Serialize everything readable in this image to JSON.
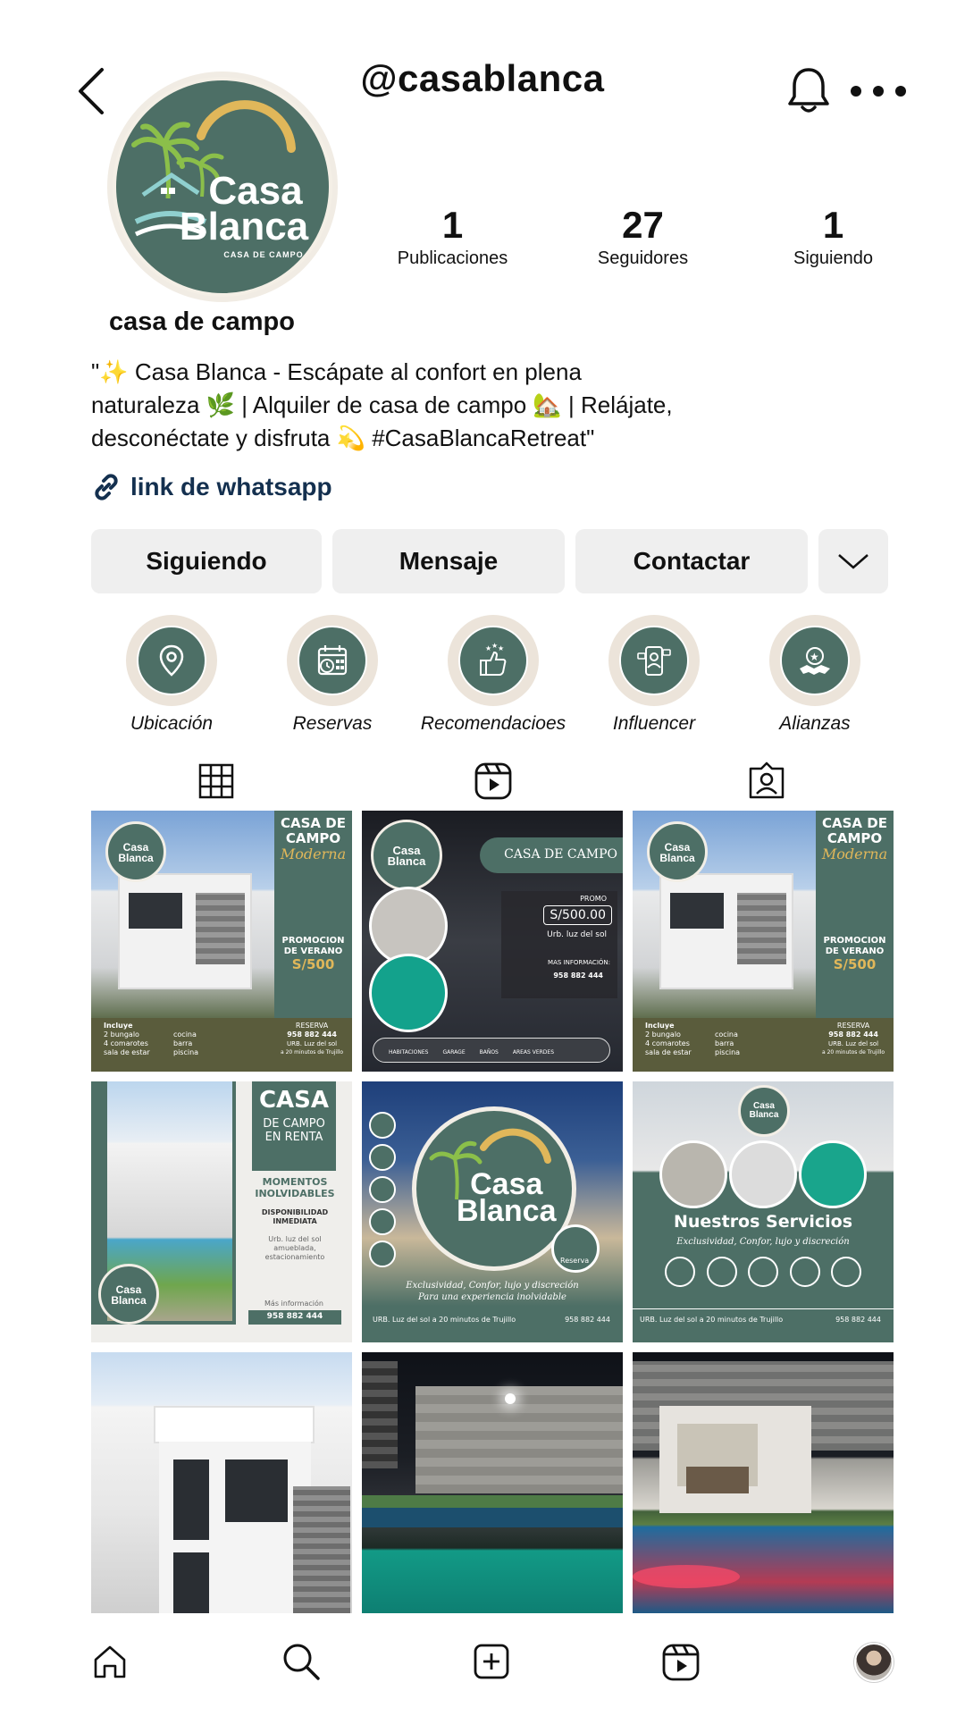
{
  "header": {
    "username": "@casablanca"
  },
  "profile": {
    "display_name": "casa de campo",
    "logo": {
      "line1": "Casa",
      "line2": "Blanca",
      "tagline": "CASA DE CAMPO"
    },
    "stats": [
      {
        "value": "1",
        "label": "Publicaciones"
      },
      {
        "value": "27",
        "label": "Seguidores"
      },
      {
        "value": "1",
        "label": "Siguiendo"
      }
    ],
    "bio_lines": [
      "\"✨ Casa Blanca - Escápate al confort en plena",
      "naturaleza 🌿 | Alquiler de casa de campo 🏡 | Relájate,",
      "desconéctate y disfruta 💫 #CasaBlancaRetreat\""
    ],
    "link_text": "link de whatsapp"
  },
  "actions": {
    "follow": "Siguiendo",
    "message": "Mensaje",
    "contact": "Contactar"
  },
  "highlights": [
    {
      "label": "Ubicación",
      "icon": "location-pin-icon"
    },
    {
      "label": "Reservas",
      "icon": "calendar-clock-icon"
    },
    {
      "label": "Recomendacioes",
      "icon": "thumbs-up-stars-icon"
    },
    {
      "label": "Influencer",
      "icon": "influencer-phone-icon"
    },
    {
      "label": "Alianzas",
      "icon": "handshake-star-icon"
    }
  ],
  "tabs": [
    "grid-icon",
    "reels-icon",
    "tagged-icon"
  ],
  "posts": {
    "moderna": {
      "title1": "CASA DE",
      "title2": "CAMPO",
      "script": "Moderna",
      "promo1": "PROMOCION",
      "promo2": "DE VERANO",
      "price": "S/500",
      "includes": "Incluye",
      "items_left": [
        "2 bungalo",
        "4 comarotes",
        "sala de estar"
      ],
      "items_right": [
        "cocina",
        "barra",
        "piscina"
      ],
      "reserve": "RESERVA",
      "phone": "958 882 444",
      "addr1": "URB. Luz del sol",
      "addr2": "a 20 minutos de Trujillo"
    },
    "promo": {
      "title": "CASA DE CAMPO",
      "promo_label": "PROMO",
      "price": "S/500.00",
      "location": "Urb. luz del sol",
      "more_info": "MAS INFORMACIÓN:",
      "phone": "958 882 444",
      "features": [
        "HABITACIONES",
        "GARAGE",
        "BAÑOS",
        "AREAS VERDES"
      ]
    },
    "renta": {
      "title": "CASA",
      "sub1": "DE CAMPO",
      "sub2": "EN RENTA",
      "moments1": "MOMENTOS",
      "moments2": "INOLVIDABLES",
      "avail1": "DISPONIBILIDAD",
      "avail2": "INMEDIATA",
      "desc1": "Urb. luz del sol",
      "desc2": "amueblada,",
      "desc3": "estacionamiento",
      "more_info": "Más información",
      "phone": "958 882 444"
    },
    "logo_post": {
      "reserve": "Reserva",
      "slogan1": "Exclusividad, Confor, lujo y discreción",
      "slogan2": "Para una experiencia inolvidable",
      "footer": "URB. Luz del sol a 20 minutos de Trujillo",
      "phone": "958 882 444"
    },
    "servicios": {
      "title": "Nuestros Servicios",
      "subtitle": "Exclusividad, Confor, lujo y discreción",
      "footer": "URB. Luz del sol a 20 minutos de Trujillo",
      "phone": "958 882 444"
    }
  },
  "bottom_nav": [
    "home-icon",
    "search-icon",
    "create-icon",
    "reels-icon",
    "profile-avatar"
  ],
  "colors": {
    "brand_green": "#4d6f66",
    "brand_gold": "#e0b75a",
    "button_bg": "#efefef",
    "link": "#14304f"
  }
}
